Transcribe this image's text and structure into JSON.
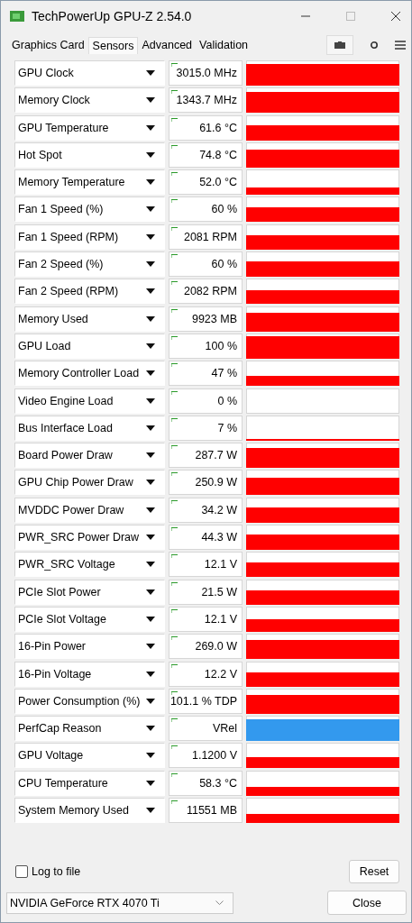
{
  "window": {
    "title": "TechPowerUp GPU-Z 2.54.0"
  },
  "tabs": [
    {
      "label": "Graphics Card",
      "selected": false
    },
    {
      "label": "Sensors",
      "selected": true
    },
    {
      "label": "Advanced",
      "selected": false
    },
    {
      "label": "Validation",
      "selected": false
    }
  ],
  "sensors": [
    {
      "name": "GPU Clock",
      "value": "3015.0 MHz",
      "color": "#ff0000"
    },
    {
      "name": "Memory Clock",
      "value": "1343.7 MHz",
      "color": "#ff0000"
    },
    {
      "name": "GPU Temperature",
      "value": "61.6 °C",
      "color": "#ff0000"
    },
    {
      "name": "Hot Spot",
      "value": "74.8 °C",
      "color": "#ff0000"
    },
    {
      "name": "Memory Temperature",
      "value": "52.0 °C",
      "color": "#ff0000"
    },
    {
      "name": "Fan 1 Speed (%)",
      "value": "60 %",
      "color": "#ff0000"
    },
    {
      "name": "Fan 1 Speed (RPM)",
      "value": "2081 RPM",
      "color": "#ff0000"
    },
    {
      "name": "Fan 2 Speed (%)",
      "value": "60 %",
      "color": "#ff0000"
    },
    {
      "name": "Fan 2 Speed (RPM)",
      "value": "2082 RPM",
      "color": "#ff0000"
    },
    {
      "name": "Memory Used",
      "value": "9923 MB",
      "color": "#ff0000"
    },
    {
      "name": "GPU Load",
      "value": "100 %",
      "color": "#ff0000"
    },
    {
      "name": "Memory Controller Load",
      "value": "47 %",
      "color": "#ff0000"
    },
    {
      "name": "Video Engine Load",
      "value": "0 %"
    },
    {
      "name": "Bus Interface Load",
      "value": "7 %",
      "color": "#ff0000"
    },
    {
      "name": "Board Power Draw",
      "value": "287.7 W",
      "color": "#ff0000"
    },
    {
      "name": "GPU Chip Power Draw",
      "value": "250.9 W",
      "color": "#ff0000"
    },
    {
      "name": "MVDDC Power Draw",
      "value": "34.2 W",
      "color": "#ff0000"
    },
    {
      "name": "PWR_SRC Power Draw",
      "value": "44.3 W",
      "color": "#ff0000"
    },
    {
      "name": "PWR_SRC Voltage",
      "value": "12.1 V",
      "color": "#ff0000"
    },
    {
      "name": "PCIe Slot Power",
      "value": "21.5 W",
      "color": "#ff0000"
    },
    {
      "name": "PCIe Slot Voltage",
      "value": "12.1 V",
      "color": "#ff0000"
    },
    {
      "name": "16-Pin Power",
      "value": "269.0 W",
      "color": "#ff0000"
    },
    {
      "name": "16-Pin Voltage",
      "value": "12.2 V",
      "color": "#ff0000"
    },
    {
      "name": "Power Consumption (%)",
      "value": "101.1 % TDP",
      "color": "#ff0000"
    },
    {
      "name": "PerfCap Reason",
      "value": "VRel",
      "color": "#3399ee"
    },
    {
      "name": "GPU Voltage",
      "value": "1.1200 V",
      "color": "#ff0000"
    },
    {
      "name": "CPU Temperature",
      "value": "58.3 °C",
      "color": "#ff0000"
    },
    {
      "name": "System Memory Used",
      "value": "11551 MB",
      "color": "#ff0000"
    }
  ],
  "log_to_file": {
    "label": "Log to file",
    "checked": false
  },
  "reset_button": "Reset",
  "gpu_select": {
    "value": "NVIDIA GeForce RTX 4070 Ti"
  },
  "close_button": "Close"
}
